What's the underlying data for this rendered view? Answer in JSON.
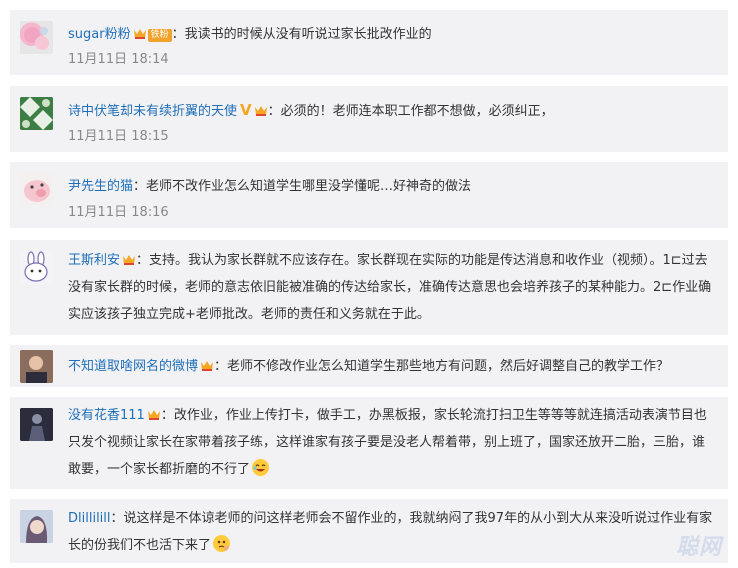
{
  "comments": [
    {
      "username": "sugar粉粉",
      "fan_tag": "铁粉",
      "text": "：我读书的时候从没有听说过家长批改作业的",
      "time": "11月11日 18:14",
      "avatar_icon": "pink-bubbles-avatar"
    },
    {
      "username": "诗中伏笔却未有续折翼的天使",
      "vip_mark": "V",
      "text": "：必须的！老师连本职工作都不想做，必须纠正，",
      "time": "11月11日 18:15",
      "avatar_icon": "green-pattern-avatar"
    },
    {
      "username": "尹先生的猫",
      "text": "：老师不改作业怎么知道学生哪里没学懂呢…好神奇的做法",
      "time": "11月11日 18:16",
      "avatar_icon": "cartoon-pig-avatar"
    },
    {
      "username": "王斯利安",
      "text": "：支持。我认为家长群就不应该存在。家长群现在实际的功能是传达消息和收作业（视频）。1⊏过去没有家长群的时候，老师的意志依旧能被准确的传达给家长，准确传达意思也会培养孩子的某种能力。2⊏作业确实应该孩子独立完成+老师批改。老师的责任和义务就在于此。",
      "avatar_icon": "cartoon-bunny-avatar"
    },
    {
      "username": "不知道取啥网名的微博",
      "text": "：老师不修改作业怎么知道学生那些地方有问题，然后好调整自己的教学工作？",
      "avatar_icon": "portrait-avatar"
    },
    {
      "username": "没有花香111",
      "text": "：改作业，作业上传打卡，做手工，办黑板报，家长轮流打扫卫生等等等就连搞活动表演节目也只发个视频让家长在家带着孩子练，这样谁家有孩子要是没老人帮着带，别上班了，国家还放开二胎，三胎，谁敢要，一个家长都折磨的不行了",
      "avatar_icon": "dark-figure-avatar"
    },
    {
      "username": "Dlillilill",
      "text": "：说这样是不体谅老师的问这样老师会不留作业的，我就纳闷了我97年的从小到大从来没听说过作业有家长的份我们不也活下来了",
      "avatar_icon": "girl-avatar"
    }
  ],
  "watermark": "聪网"
}
